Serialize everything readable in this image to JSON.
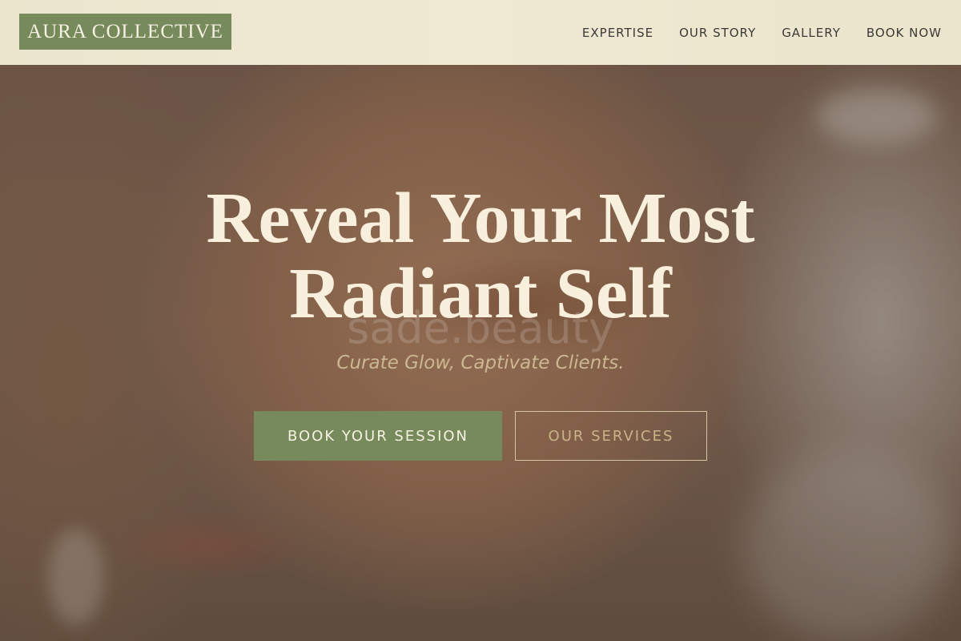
{
  "brand": {
    "name": "AURA COLLECTIVE",
    "accent": "#768a5c"
  },
  "nav": {
    "items": [
      {
        "label": "EXPERTISE"
      },
      {
        "label": "OUR STORY"
      },
      {
        "label": "GALLERY"
      },
      {
        "label": "BOOK NOW"
      }
    ]
  },
  "hero": {
    "headline_line1": "Reveal Your Most",
    "headline_line2": "Radiant Self",
    "watermark": "sade.beauty",
    "tagline": "Curate Glow, Captivate Clients.",
    "primary_cta": "BOOK YOUR SESSION",
    "secondary_cta": "OUR SERVICES"
  }
}
